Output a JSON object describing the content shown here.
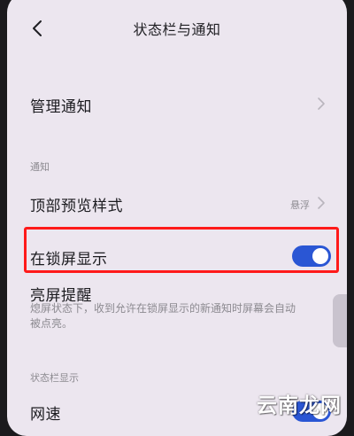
{
  "header": {
    "title": "状态栏与通知",
    "back_icon": "chevron-left-icon"
  },
  "rows": {
    "manage_notifications": {
      "label": "管理通知"
    },
    "top_preview_style": {
      "label": "顶部预览样式",
      "value": "悬浮"
    },
    "lock_screen_display": {
      "label": "在锁屏显示",
      "toggle": "on"
    },
    "screen_wake_reminder": {
      "label": "亮屏提醒",
      "description": "熄屏状态下，收到允许在锁屏显示的新通知时屏幕会自动被点亮。"
    },
    "network_speed": {
      "label": "网速",
      "toggle": "on"
    }
  },
  "sections": {
    "notifications": "通知",
    "status_bar_display": "状态栏显示"
  },
  "watermark": "云南龙网",
  "colors": {
    "toggle_on": "#2a56d4",
    "highlight": "#ff1a1a",
    "background": "#ece6ef"
  }
}
